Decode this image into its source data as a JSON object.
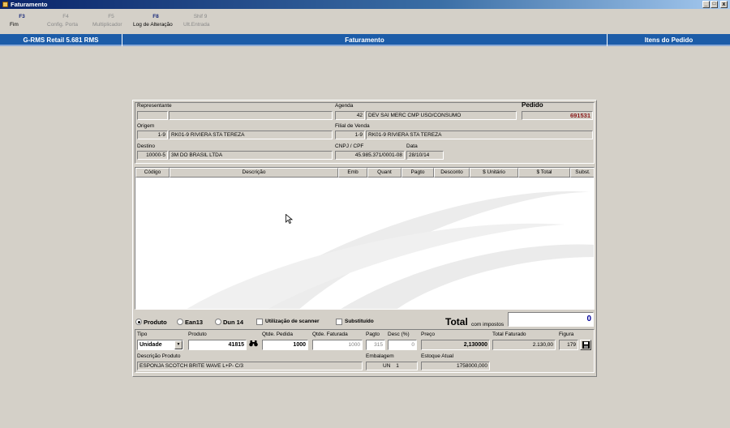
{
  "window": {
    "title": "Faturamento",
    "buttons": {
      "minimize": "_",
      "maximize": "□",
      "close": "x"
    }
  },
  "toolbar": [
    {
      "key": "F3",
      "label": "Fim",
      "enabled": true
    },
    {
      "key": "F4",
      "label": "Config. Porta",
      "enabled": false
    },
    {
      "key": "F5",
      "label": "Multiplicador",
      "enabled": false
    },
    {
      "key": "F8",
      "label": "Log de Alteração",
      "enabled": true
    },
    {
      "key": "Shif 9",
      "label": "Ult.Entrada",
      "enabled": false
    }
  ],
  "header": {
    "left": "G-RMS Retail 5.681 RMS",
    "center": "Faturamento",
    "right": "Itens do Pedido"
  },
  "form": {
    "representante": {
      "label": "Representante",
      "code": "",
      "name": ""
    },
    "agenda": {
      "label": "Agenda",
      "code": "42",
      "desc": "DEV SAI MERC CMP USO/CONSUMO"
    },
    "pedido": {
      "label": "Pedido",
      "value": "691531"
    },
    "origem": {
      "label": "Origem",
      "code": "1-9",
      "name": "RK01-9 RIVIERA STA TEREZA"
    },
    "filial": {
      "label": "Filial de Venda",
      "code": "1-9",
      "name": "RK01-9 RIVIERA STA TEREZA"
    },
    "destino": {
      "label": "Destino",
      "code": "10000-5",
      "name": "3M DO BRASIL LTDA"
    },
    "cnpj": {
      "label": "CNPJ / CPF",
      "value": "45.985.371/0001-08"
    },
    "data": {
      "label": "Data",
      "value": "28/10/14"
    }
  },
  "grid": {
    "columns": [
      "Código",
      "Descrição",
      "Emb",
      "Quant",
      "Pagto",
      "Desconto",
      "$ Unitário",
      "$ Total",
      "Subst."
    ],
    "rows": []
  },
  "options": {
    "produto": "Produto",
    "ean13": "Ean13",
    "dun14": "Dun 14",
    "scanner": "Utilização de scanner",
    "substituido": "Substituído",
    "total_label": "Total",
    "total_sub": "com impostos",
    "total_value": "0"
  },
  "item": {
    "tipo": {
      "label": "Tipo",
      "value": "Unidade"
    },
    "produto": {
      "label": "Produto",
      "value": "41815"
    },
    "qtde_pedida": {
      "label": "Qtde. Pedida",
      "value": "1000"
    },
    "qtde_faturada": {
      "label": "Qtde. Faturada",
      "value": "1000"
    },
    "pagto": {
      "label": "Pagto",
      "value": "315"
    },
    "desc": {
      "label": "Desc (%)",
      "value": "0"
    },
    "preco": {
      "label": "Preço",
      "value": "2,130000"
    },
    "total_faturado": {
      "label": "Total Faturado",
      "value": "2.130,00"
    },
    "figura": {
      "label": "Figura",
      "value": "179"
    },
    "descricao": {
      "label": "Descrição Produto",
      "value": "ESPONJA SCOTCH BRITE WAVE L+P- C/3"
    },
    "embalagem": {
      "label": "Embalagem",
      "un": "UN",
      "qtd": "1"
    },
    "estoque": {
      "label": "Estoque Atual",
      "value": "1758000,000"
    }
  },
  "icons": {
    "search": "binoculars-icon",
    "save": "floppy-icon",
    "dropdown": "▼"
  },
  "colors": {
    "header_blue": "#1c5ca8",
    "pedido_red": "#8b1a1a",
    "total_blue": "#000099"
  }
}
